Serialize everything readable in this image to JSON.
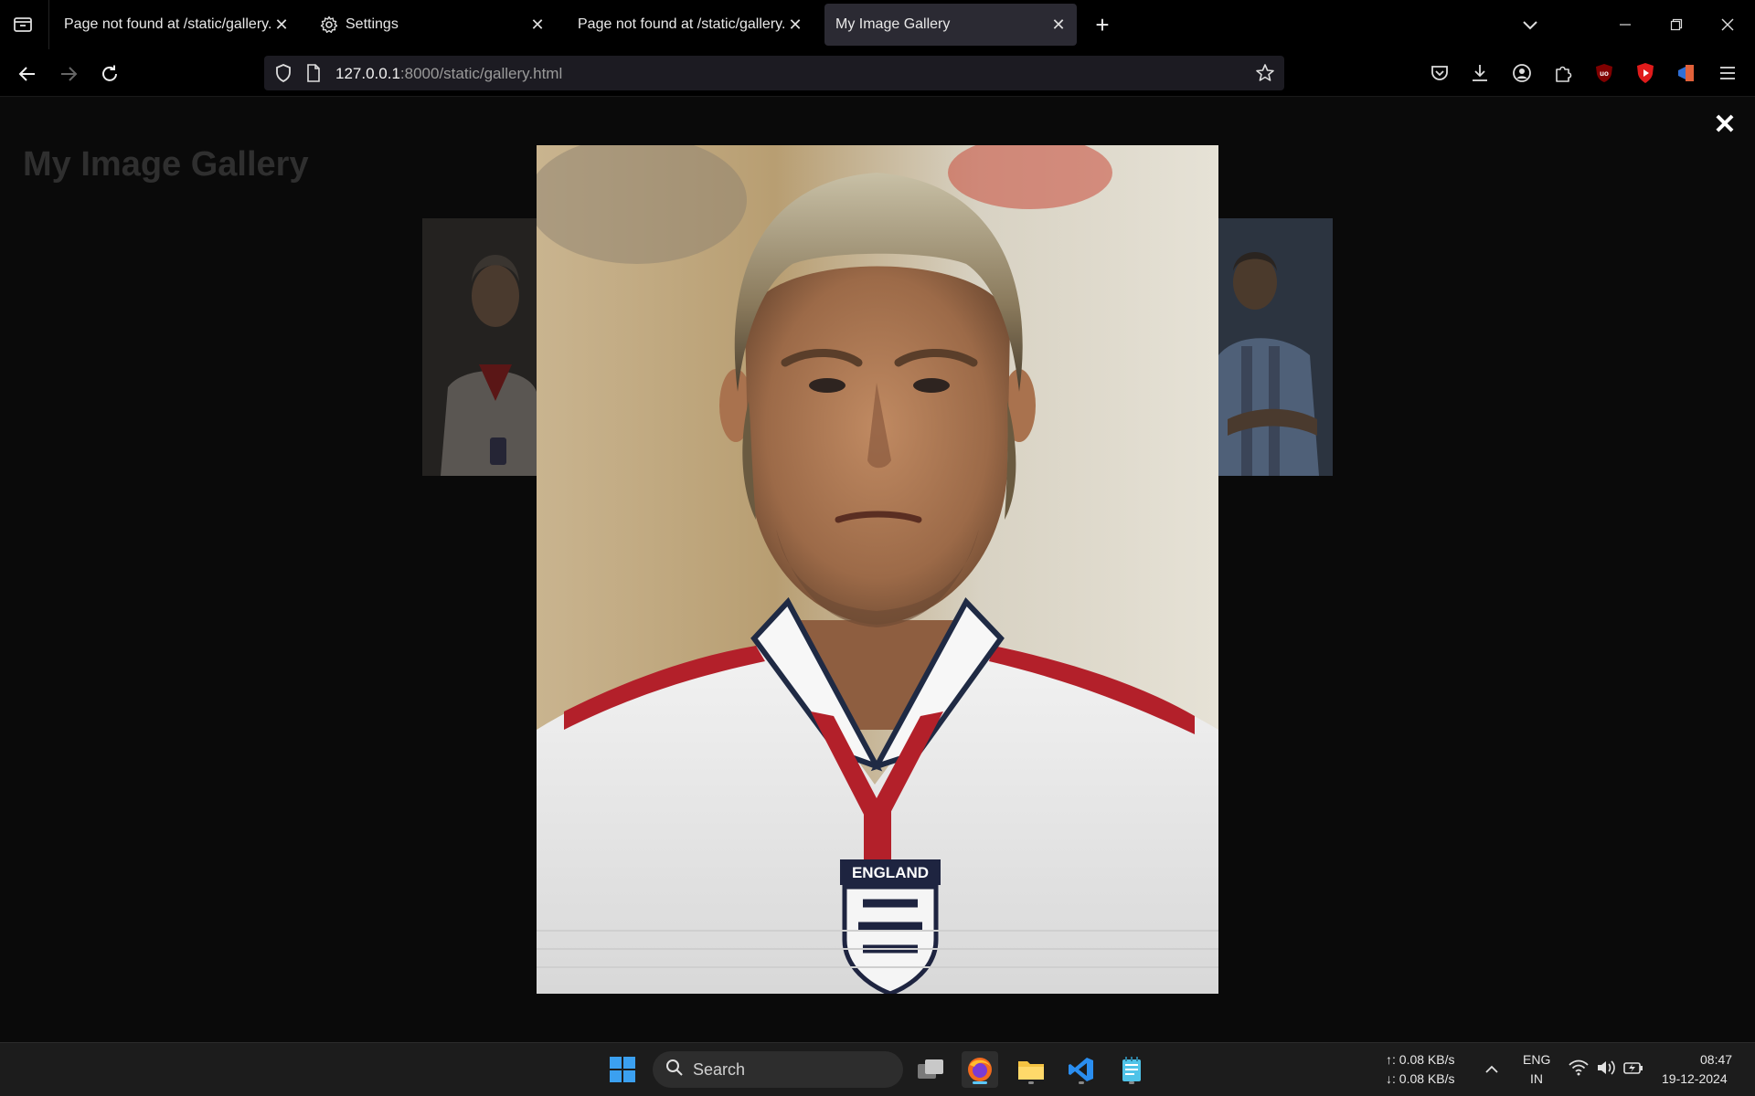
{
  "browser": {
    "tabs": [
      {
        "label": "Page not found at /static/gallery.htm",
        "icon": "page-icon",
        "active": false
      },
      {
        "label": "Settings",
        "icon": "gear-icon",
        "active": false
      },
      {
        "label": "Page not found at /static/gallery.htm",
        "icon": "page-icon",
        "active": false
      },
      {
        "label": "My Image Gallery",
        "icon": "none",
        "active": true
      }
    ],
    "new_tab_label": "+",
    "close_glyph": "✕",
    "url": {
      "host": "127.0.0.1",
      "rest": ":8000/static/gallery.html"
    }
  },
  "page": {
    "title": "My Image Gallery",
    "lightbox_close": "✕",
    "thumbnails": [
      {
        "name": "footballer-england-thumbnail",
        "subject": "player in England shirt"
      },
      {
        "name": "footballer-argentina-thumbnail",
        "subject": "player in Argentina shirt"
      }
    ],
    "lightbox_image": {
      "subject": "footballer in white England shirt",
      "badge_text": "ENGLAND"
    }
  },
  "taskbar": {
    "search_label": "Search",
    "network_up": "↑: 0.08 KB/s",
    "network_down": "↓: 0.08 KB/s",
    "lang_top": "ENG",
    "lang_bottom": "IN",
    "time": "08:47",
    "date": "19-12-2024"
  },
  "colors": {
    "accent": "#5cc8ff",
    "active_tab": "#2b2a33",
    "urlbar": "#1c1b22"
  }
}
